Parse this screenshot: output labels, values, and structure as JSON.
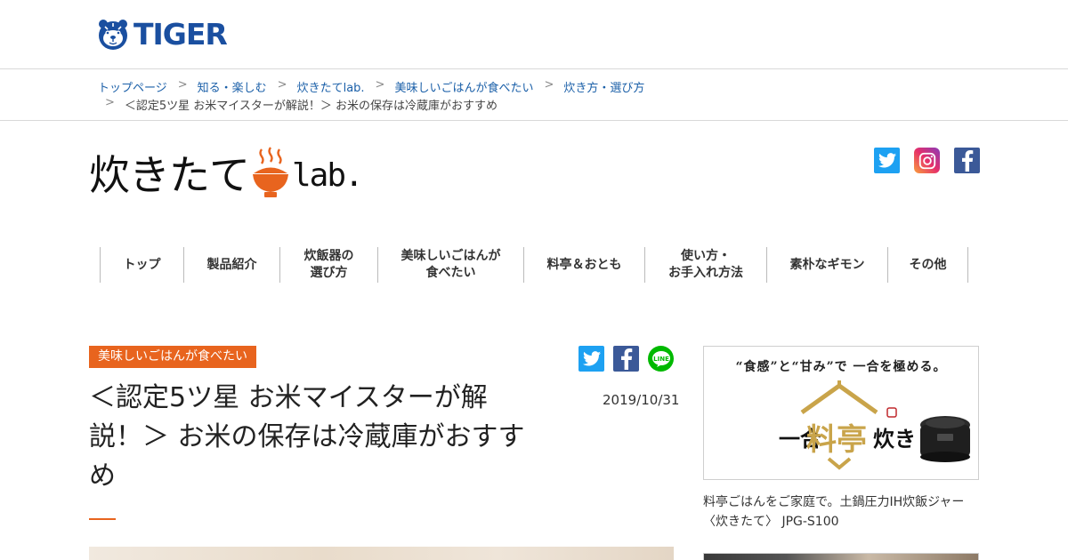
{
  "header": {
    "brand": "TIGER"
  },
  "breadcrumb": {
    "items": [
      {
        "label": "トップページ"
      },
      {
        "label": "知る・楽しむ"
      },
      {
        "label": "炊きたてlab."
      },
      {
        "label": "美味しいごはんが食べたい"
      },
      {
        "label": "炊き方・選び方"
      }
    ],
    "separator": ">",
    "current": "＜認定5ツ星 お米マイスターが解説！＞ お米の保存は冷蔵庫がおすすめ"
  },
  "lab_logo": {
    "main": "炊きたて",
    "suffix": "lab."
  },
  "social": {
    "twitter": "twitter-icon",
    "instagram": "instagram-icon",
    "facebook": "facebook-icon"
  },
  "nav": {
    "items": [
      {
        "label": "トップ"
      },
      {
        "label": "製品紹介"
      },
      {
        "label": "炊飯器の\n選び方"
      },
      {
        "label": "美味しいごはんが\n食べたい"
      },
      {
        "label": "料亭＆おとも"
      },
      {
        "label": "使い方・\nお手入れ方法"
      },
      {
        "label": "素朴なギモン"
      },
      {
        "label": "その他"
      }
    ]
  },
  "article": {
    "category": "美味しいごはんが食べたい",
    "title": "＜認定5ツ星 お米マイスターが解説！＞ お米の保存は冷蔵庫がおすすめ",
    "date": "2019/10/31"
  },
  "sidebar": {
    "ad": {
      "tagline": "“食感”と“甘み”で 一合を極める。",
      "logo_text_left": "一合",
      "logo_text_center": "料亭",
      "logo_text_right": "炊き"
    },
    "caption": "料亭ごはんをご家庭で。土鍋圧力IH炊飯ジャー〈炊きたて〉 JPG-S100"
  },
  "colors": {
    "accent": "#e8641e",
    "link": "#1a5fa8",
    "brand_blue": "#1a4fa0",
    "twitter": "#1da1f2",
    "facebook": "#3b5998",
    "line": "#00b900"
  }
}
